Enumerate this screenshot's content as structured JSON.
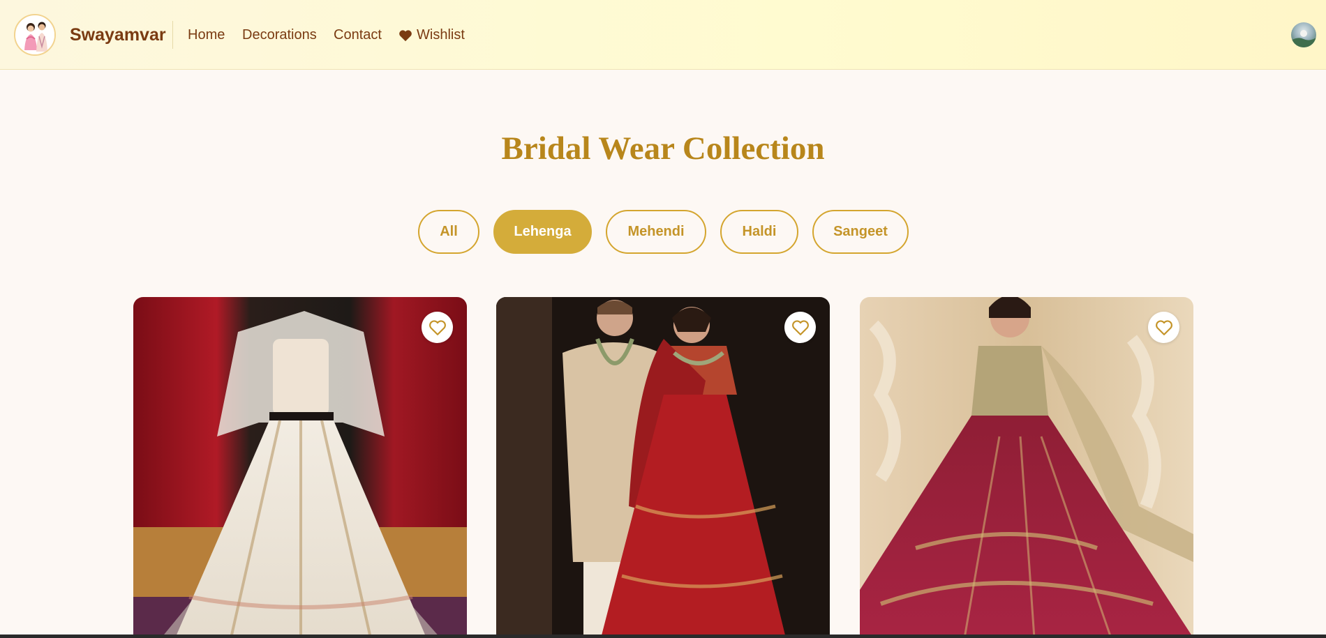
{
  "header": {
    "brand": "Swayamvar",
    "nav": {
      "home": "Home",
      "decorations": "Decorations",
      "contact": "Contact",
      "wishlist": "Wishlist"
    }
  },
  "main": {
    "title": "Bridal Wear Collection",
    "filters": [
      "All",
      "Lehenga",
      "Mehendi",
      "Haldi",
      "Sangeet"
    ],
    "active_filter": "Lehenga"
  },
  "cards": [
    {
      "image": "white-lehenga-on-mannequin",
      "favorite_icon": "heart-outline-icon"
    },
    {
      "image": "couple-in-sherwani-and-red-lehenga",
      "favorite_icon": "heart-outline-icon"
    },
    {
      "image": "bride-in-maroon-lehenga",
      "favorite_icon": "heart-outline-icon"
    }
  ],
  "colors": {
    "brand_brown": "#7a3b12",
    "gold": "#b8861b",
    "active_filter_bg": "#d4ac3a",
    "page_bg": "#fdf8f4"
  }
}
